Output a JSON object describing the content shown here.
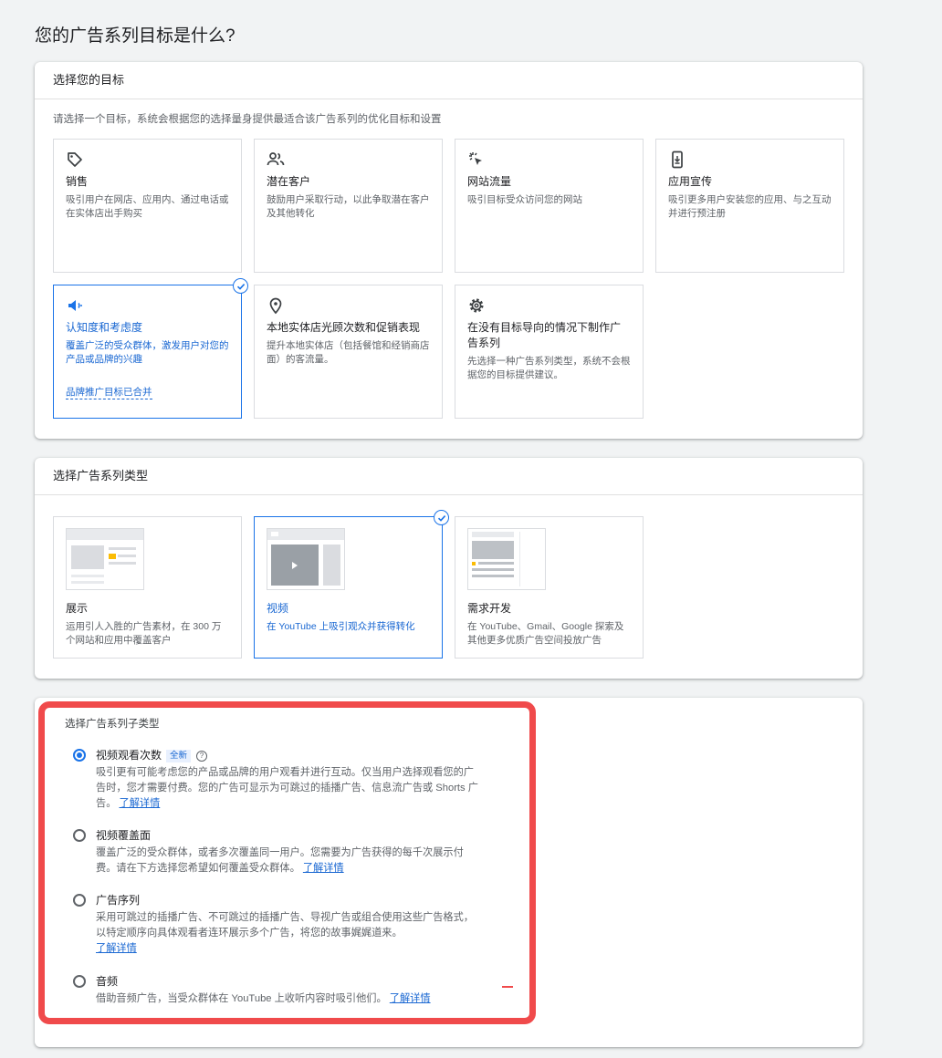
{
  "page_title": "您的广告系列目标是什么?",
  "goals": {
    "header": "选择您的目标",
    "intro": "请选择一个目标，系统会根据您的选择量身提供最适合该广告系列的优化目标和设置",
    "cards": [
      {
        "icon": "tag-icon",
        "title": "销售",
        "desc": "吸引用户在网店、应用内、通过电话或在实体店出手购买",
        "selected": false
      },
      {
        "icon": "people-icon",
        "title": "潜在客户",
        "desc": "鼓励用户采取行动，以此争取潜在客户及其他转化",
        "selected": false
      },
      {
        "icon": "cursor-click-icon",
        "title": "网站流量",
        "desc": "吸引目标受众访问您的网站",
        "selected": false
      },
      {
        "icon": "phone-download-icon",
        "title": "应用宣传",
        "desc": "吸引更多用户安装您的应用、与之互动并进行预注册",
        "selected": false
      },
      {
        "icon": "megaphone-icon",
        "title": "认知度和考虑度",
        "desc": "覆盖广泛的受众群体，激发用户对您的产品或品牌的兴趣",
        "link": "品牌推广目标已合并",
        "selected": true
      },
      {
        "icon": "location-pin-icon",
        "title": "本地实体店光顾次数和促销表现",
        "desc": "提升本地实体店（包括餐馆和经销商店面）的客流量。",
        "selected": false
      },
      {
        "icon": "gear-icon",
        "title": "在没有目标导向的情况下制作广告系列",
        "desc": "先选择一种广告系列类型，系统不会根据您的目标提供建议。",
        "selected": false
      }
    ]
  },
  "types": {
    "header": "选择广告系列类型",
    "cards": [
      {
        "title": "展示",
        "desc": "运用引人入胜的广告素材，在 300 万个网站和应用中覆盖客户",
        "selected": false
      },
      {
        "title": "视频",
        "desc": "在 YouTube 上吸引观众并获得转化",
        "selected": true
      },
      {
        "title": "需求开发",
        "desc": "在 YouTube、Gmail、Google 探索及其他更多优质广告空间投放广告",
        "selected": false
      }
    ]
  },
  "subtypes": {
    "header": "选择广告系列子类型",
    "options": [
      {
        "title": "视频观看次数",
        "badge": "全新",
        "help": "?",
        "desc": "吸引更有可能考虑您的产品或品牌的用户观看并进行互动。仅当用户选择观看您的广告时，您才需要付费。您的广告可显示为可跳过的插播广告、信息流广告或 Shorts 广告。",
        "link": "了解详情",
        "selected": true
      },
      {
        "title": "视频覆盖面",
        "desc": "覆盖广泛的受众群体，或者多次覆盖同一用户。您需要为广告获得的每千次展示付费。请在下方选择您希望如何覆盖受众群体。",
        "link": "了解详情",
        "selected": false
      },
      {
        "title": "广告序列",
        "desc": "采用可跳过的插播广告、不可跳过的插播广告、导视广告或组合使用这些广告格式，以特定顺序向具体观看者连环展示多个广告，将您的故事娓娓道来。",
        "link": "了解详情",
        "selected": false
      },
      {
        "title": "音频",
        "desc": "借助音频广告，当受众群体在 YouTube 上收听内容时吸引他们。",
        "link": "了解详情",
        "selected": false
      }
    ]
  },
  "colors": {
    "accent": "#1a73e8",
    "highlight_box": "#f04a4b",
    "badge_bg": "#e8f0fe"
  }
}
